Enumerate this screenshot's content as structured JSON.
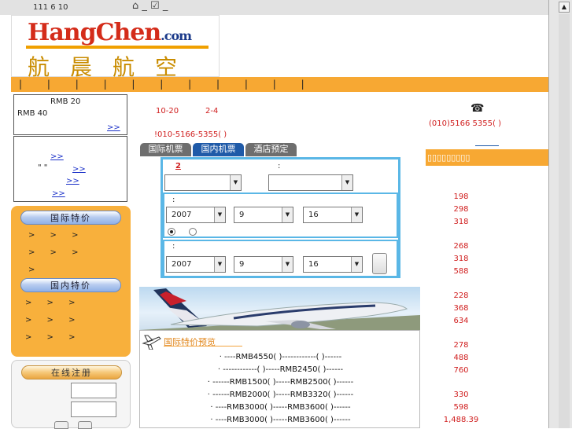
{
  "topbar": {
    "numbers": "111 6 10",
    "icons": [
      "home-icon",
      "checkbox-icon"
    ]
  },
  "logo": {
    "en_hang": "Hang",
    "en_chen": "Chen",
    "en_com": ".com",
    "cn": "航晨航空"
  },
  "navbar": {
    "ticks": "| | | | | | | | | | |"
  },
  "leftbox1": {
    "line1": "RMB 20",
    "line2": "RMB 40",
    "more": ">>"
  },
  "leftbox2": {
    "link1": ">>",
    "quote": "\"  \"",
    "link2": ">>",
    "link3": ">>",
    "link4": ">>"
  },
  "left_panel": {
    "intl_title": "国际特价",
    "intl_rows": [
      ">  >  >",
      ">  >  >",
      ">"
    ],
    "dom_title": "国内特价",
    "dom_rows": [
      ">  >  >",
      ">  >  >",
      ">  >  >"
    ]
  },
  "register": {
    "title": "在线注册"
  },
  "center": {
    "date_range_a": "10-20",
    "date_range_b": "2-4",
    "phone_notice": "!010-5166-5355( )",
    "tabs": [
      "国际机票",
      "国内机票",
      "酒店预定"
    ],
    "step_mark": "2",
    "colon": ":",
    "date1": {
      "year": "2007",
      "month": "9",
      "day": "16"
    },
    "date2": {
      "year": "2007",
      "month": "9",
      "day": "16"
    },
    "intl_preview_title": "国际特价预览",
    "fares": [
      "·  ----RMB4550(  )------------(  )------",
      "·  ------------(  )-----RMB2450(  )------",
      "·  ------RMB1500(  )-----RMB2500(  )------",
      "·  ------RMB2000(  )-----RMB3320(  )------",
      "·  ----RMB3000(  )-----RMB3600(  )------",
      "·  ----RMB3000(  )-----RMB3600(  )------"
    ]
  },
  "right": {
    "phone": "(010)5166 5355(  )",
    "header_blocks": "▯▯▯▯▯▯▯▯▯",
    "prices": [
      "198",
      "298",
      "318",
      "268",
      "318",
      "588",
      "228",
      "368",
      "634",
      "278",
      "488",
      "760",
      "330",
      "598",
      "1,488.39"
    ]
  },
  "colors": {
    "orange": "#f7a833",
    "blue_border": "#5ab7e6",
    "red": "#d01e1e",
    "tab_blue": "#1f5aa8",
    "tab_grey": "#6e6e6e"
  }
}
